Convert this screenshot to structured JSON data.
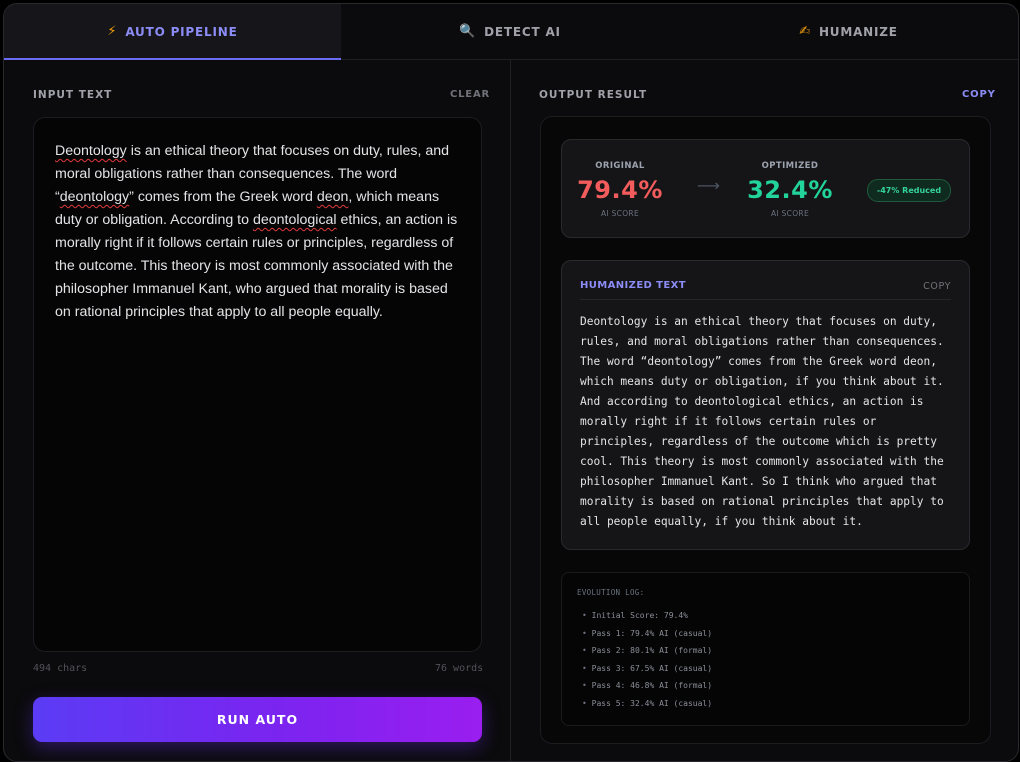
{
  "tabs": [
    {
      "icon": "⚡",
      "icon_name": "lightning-icon",
      "label": "AUTO PIPELINE",
      "active": true
    },
    {
      "icon": "🔍",
      "icon_name": "magnifier-icon",
      "label": "DETECT AI",
      "active": false
    },
    {
      "icon": "✍",
      "icon_name": "writing-hand-icon",
      "label": "HUMANIZE",
      "active": false
    }
  ],
  "input": {
    "label": "INPUT TEXT",
    "clear_label": "CLEAR",
    "segments": [
      {
        "t": "Deontology",
        "s": true
      },
      {
        "t": " is an ethical theory that focuses on duty, rules, and moral obligations rather than consequences. The word “",
        "s": false
      },
      {
        "t": "deontology",
        "s": true
      },
      {
        "t": "” comes from the Greek word ",
        "s": false
      },
      {
        "t": "deon",
        "s": true
      },
      {
        "t": ", which means duty or obligation. According to ",
        "s": false
      },
      {
        "t": "deontological",
        "s": true
      },
      {
        "t": " ethics, an action is morally right if it follows certain rules or principles, regardless of the outcome. This theory is most commonly associated with the philosopher Immanuel Kant, who argued that morality is based on rational principles that apply to all people equally.",
        "s": false
      }
    ],
    "chars": "494 chars",
    "words": "76 words",
    "run_label": "RUN AUTO"
  },
  "output": {
    "label": "OUTPUT RESULT",
    "copy_label": "COPY",
    "original": {
      "label": "ORIGINAL",
      "value": "79.4%",
      "sub": "AI SCORE"
    },
    "optimized": {
      "label": "OPTIMIZED",
      "value": "32.4%",
      "sub": "AI SCORE"
    },
    "arrow": "⟶",
    "badge": "-47% Reduced",
    "humanized": {
      "title": "HUMANIZED TEXT",
      "copy_label": "COPY",
      "text": "Deontology is an ethical theory that focuses on duty, rules, and moral obligations rather than consequences. The word “deontology” comes from the Greek word deon, which means duty or obligation, if you think about it. And according to deontological ethics, an action is morally right if it follows certain rules or principles, regardless of the outcome which is pretty cool. This theory is most commonly associated with the philosopher Immanuel Kant. So I think who argued that morality is based on rational principles that apply to all people equally, if you think about it."
    },
    "log": {
      "title": "EVOLUTION LOG:",
      "items": [
        "Initial Score: 79.4%",
        "Pass 1: 79.4% AI (casual)",
        "Pass 2: 80.1% AI (formal)",
        "Pass 3: 67.5% AI (casual)",
        "Pass 4: 46.8% AI (formal)",
        "Pass 5: 32.4% AI (casual)"
      ]
    }
  },
  "colors": {
    "accent": "#8b8cf5",
    "original_score": "#f25c5c",
    "optimized_score": "#22d39b",
    "button_gradient_start": "#5b3cf5",
    "button_gradient_end": "#9a1ef0"
  }
}
